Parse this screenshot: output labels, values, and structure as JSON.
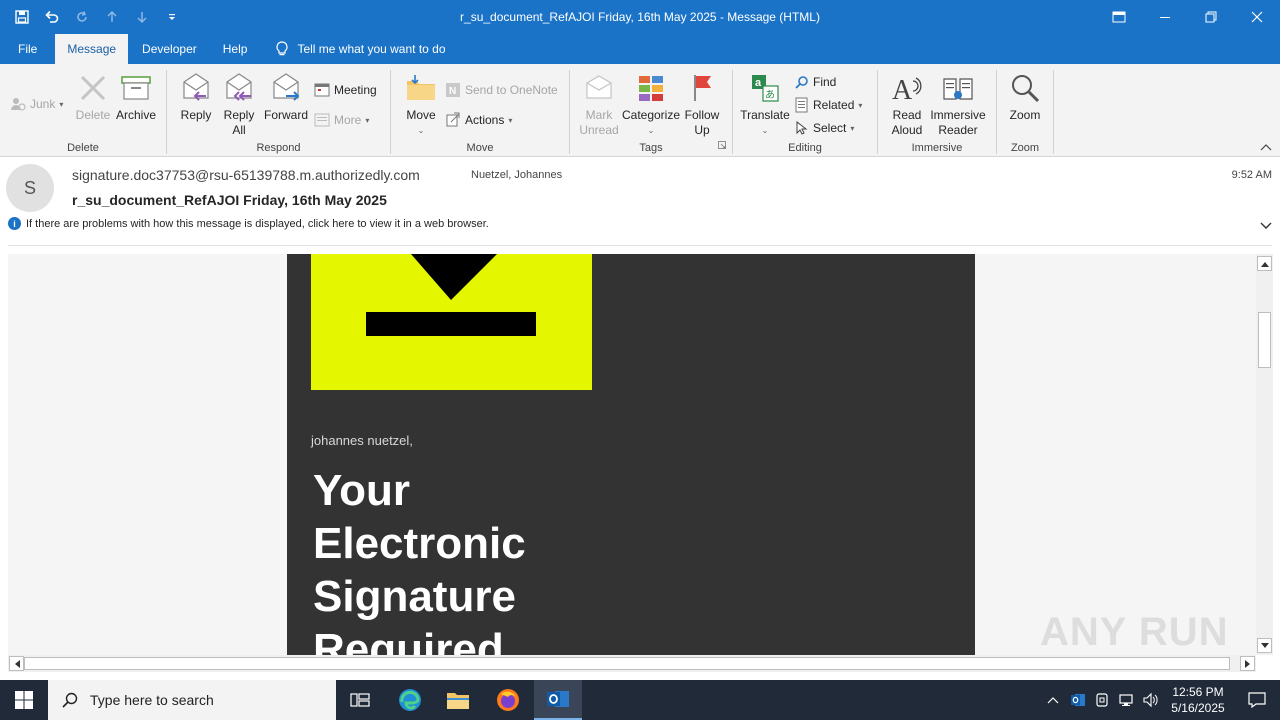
{
  "window": {
    "title": "r_su_document_RefAJOI Friday, 16th May 2025  -  Message (HTML)"
  },
  "menu": {
    "tabs": [
      "File",
      "Message",
      "Developer",
      "Help"
    ],
    "tell_me": "Tell me what you want to do"
  },
  "ribbon": {
    "delete_group": {
      "label": "Delete",
      "junk": "Junk",
      "delete": "Delete",
      "archive": "Archive"
    },
    "respond_group": {
      "label": "Respond",
      "reply": "Reply",
      "reply_all_1": "Reply",
      "reply_all_2": "All",
      "forward": "Forward",
      "meeting": "Meeting",
      "more": "More"
    },
    "move_group": {
      "label": "Move",
      "move": "Move",
      "send_onenote": "Send to OneNote",
      "actions": "Actions"
    },
    "tags_group": {
      "label": "Tags",
      "mark_unread_1": "Mark",
      "mark_unread_2": "Unread",
      "categorize": "Categorize",
      "follow_up_1": "Follow",
      "follow_up_2": "Up"
    },
    "editing_group": {
      "label": "Editing",
      "translate": "Translate",
      "find": "Find",
      "related": "Related",
      "select": "Select"
    },
    "immersive_group": {
      "label": "Immersive",
      "read_aloud_1": "Read",
      "read_aloud_2": "Aloud",
      "immersive_reader_1": "Immersive",
      "immersive_reader_2": "Reader"
    },
    "zoom_group": {
      "label": "Zoom",
      "zoom": "Zoom"
    }
  },
  "message": {
    "avatar_initial": "S",
    "sender": "signature.doc37753@rsu-65139788.m.authorizedly.com",
    "recipient": "Nuetzel, Johannes",
    "time": "9:52 AM",
    "subject": "r_su_document_RefAJOI Friday, 16th May 2025",
    "info_bar": "If there are problems with how this message is displayed, click here to view it in a web browser."
  },
  "body": {
    "greeting": "johannes nuetzel,",
    "headline": "Your Electronic Signature Required"
  },
  "watermark": "ANY RUN",
  "taskbar": {
    "search_placeholder": "Type here to search",
    "time": "12:56 PM",
    "date": "5/16/2025"
  },
  "colors": {
    "brand_blue": "#1a73c7",
    "email_bg": "#333333",
    "accent_yellow": "#e4f701"
  }
}
